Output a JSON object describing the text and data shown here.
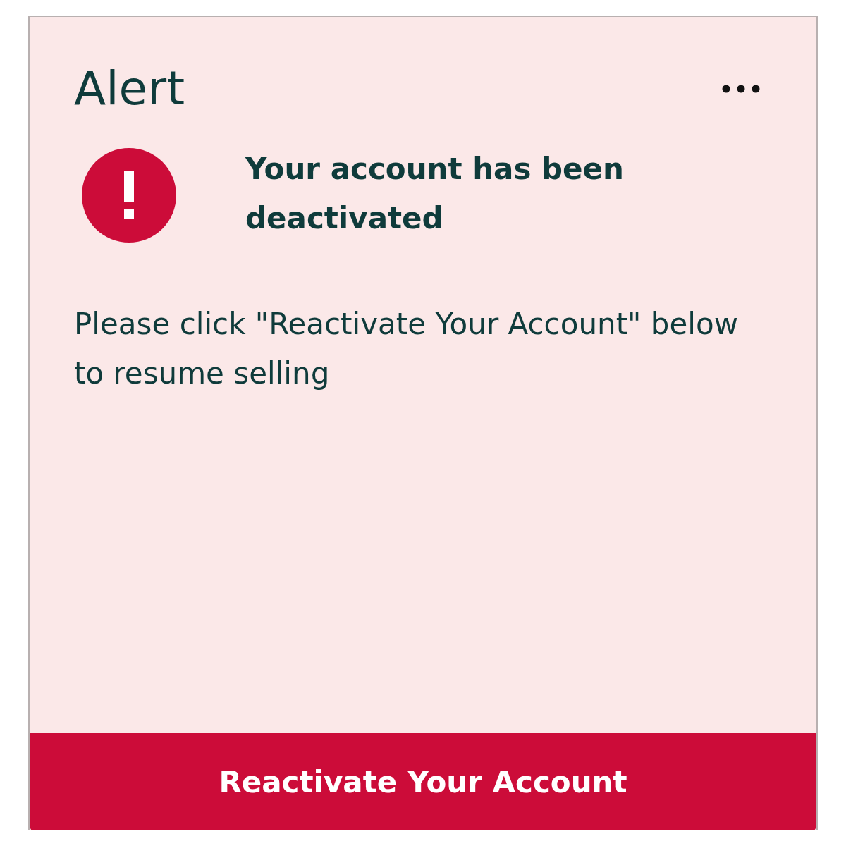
{
  "card": {
    "title": "Alert",
    "alert": {
      "heading": "Your account has been deactivated",
      "message": "Please click \"Reactivate Your Account\" below to resume selling"
    },
    "button": {
      "label": "Reactivate Your Account"
    }
  }
}
